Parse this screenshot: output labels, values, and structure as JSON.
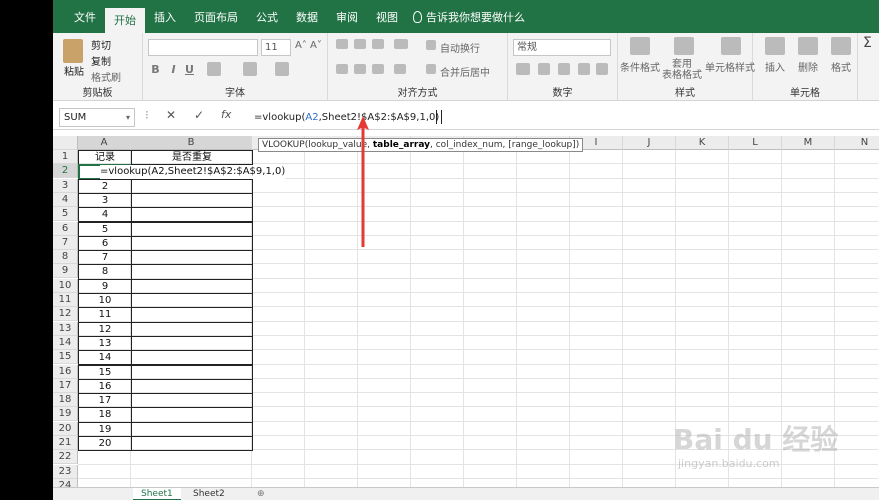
{
  "tabs": [
    "文件",
    "开始",
    "插入",
    "页面布局",
    "公式",
    "数据",
    "审阅",
    "视图"
  ],
  "tell_me": "告诉我你想要做什么",
  "ribbon": {
    "clipboard": {
      "paste": "粘贴",
      "cut": "剪切",
      "copy": "复制",
      "painter": "格式刷",
      "label": "剪贴板"
    },
    "font": {
      "size": "11",
      "label": "字体",
      "bold": "B",
      "italic": "I",
      "underline": "U"
    },
    "align": {
      "wrap": "自动换行",
      "merge": "合并后居中",
      "label": "对齐方式"
    },
    "number": {
      "format": "常规",
      "label": "数字"
    },
    "styles": {
      "cond": "条件格式",
      "table": "套用\n表格格式",
      "cell": "单元格样式",
      "label": "样式"
    },
    "cells": {
      "insert": "插入",
      "delete": "删除",
      "format": "格式",
      "label": "单元格"
    }
  },
  "namebox": "SUM",
  "formula": {
    "pre": "=vlookup(",
    "ref": "A2",
    "post": ",Sheet2!$A$2:$A$9,1,0)"
  },
  "tooltip": {
    "a": "VLOOKUP(lookup_value, ",
    "b": "table_array",
    "c": ", col_index_num, [range_lookup])"
  },
  "columns": [
    "A",
    "B",
    "C",
    "D",
    "E",
    "F",
    "G",
    "H",
    "I",
    "J",
    "K",
    "L",
    "M",
    "N"
  ],
  "rows": [
    "1",
    "2",
    "3",
    "4",
    "5",
    "6",
    "7",
    "8",
    "9",
    "10",
    "11",
    "12",
    "13",
    "14",
    "15",
    "16",
    "17",
    "18",
    "19",
    "20",
    "21",
    "22",
    "23",
    "24"
  ],
  "header_a": "记录",
  "header_b": "是否重复",
  "editing_cell": "=vlookup(A2,Sheet2!$A$2:$A$9,1,0)",
  "col_a_values": [
    "2",
    "3",
    "4",
    "5",
    "6",
    "7",
    "8",
    "9",
    "10",
    "11",
    "12",
    "13",
    "14",
    "15",
    "16",
    "17",
    "18",
    "19",
    "20"
  ],
  "sheets": [
    "Sheet1",
    "Sheet2"
  ],
  "watermark": "Bai du 经验",
  "watermark_url": "jingyan.baidu.com",
  "colors": {
    "accent": "#217346",
    "arrow": "#e53935"
  }
}
